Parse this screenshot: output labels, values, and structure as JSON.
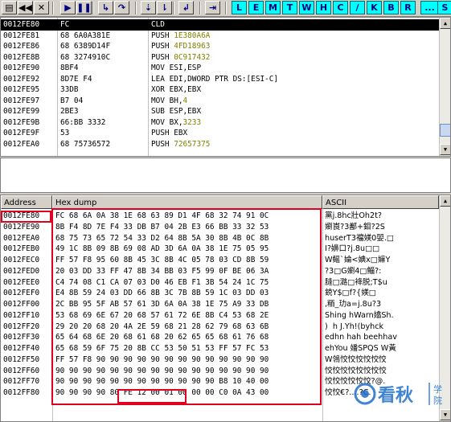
{
  "toolbar": {
    "buttons": [
      {
        "icon": "open-icon",
        "label": "▤"
      },
      {
        "icon": "rewind-icon",
        "label": "◀◀"
      },
      {
        "icon": "close-icon",
        "label": "✕"
      },
      {
        "icon": "run-icon",
        "label": "▶"
      },
      {
        "icon": "pause-icon",
        "label": "❚❚"
      },
      {
        "icon": "step-into-icon",
        "label": "↳"
      },
      {
        "icon": "step-over-icon",
        "label": "↷"
      },
      {
        "icon": "trace-into-icon",
        "label": "⇣"
      },
      {
        "icon": "trace-over-icon",
        "label": "⇂"
      },
      {
        "icon": "execute-till-return-icon",
        "label": "↲"
      },
      {
        "icon": "goto-icon",
        "label": "⇥"
      }
    ],
    "letters": [
      "L",
      "E",
      "M",
      "T",
      "W",
      "H",
      "C",
      "/",
      "K",
      "B",
      "R",
      "...",
      "S"
    ]
  },
  "disasm": {
    "rows": [
      {
        "addr": "0012FE80",
        "hex": "FC",
        "mnem": "CLD",
        "arg": ""
      },
      {
        "addr": "0012FE81",
        "hex": "68 6A0A381E",
        "mnem": "PUSH ",
        "arg": "1E380A6A"
      },
      {
        "addr": "0012FE86",
        "hex": "68 6389D14F",
        "mnem": "PUSH ",
        "arg": "4FD18963"
      },
      {
        "addr": "0012FE8B",
        "hex": "68 3274910C",
        "mnem": "PUSH ",
        "arg": "0C917432"
      },
      {
        "addr": "0012FE90",
        "hex": "8BF4",
        "mnem": "MOV ESI,ESP",
        "arg": ""
      },
      {
        "addr": "0012FE92",
        "hex": "8D7E F4",
        "mnem": "LEA EDI,DWORD PTR DS:[ESI-C]",
        "arg": ""
      },
      {
        "addr": "0012FE95",
        "hex": "33DB",
        "mnem": "XOR EBX,EBX",
        "arg": ""
      },
      {
        "addr": "0012FE97",
        "hex": "B7 04",
        "mnem": "MOV BH,",
        "arg": "4"
      },
      {
        "addr": "0012FE99",
        "hex": "2BE3",
        "mnem": "SUB ESP,EBX",
        "arg": ""
      },
      {
        "addr": "0012FE9B",
        "hex": "66:BB 3332",
        "mnem": "MOV BX,",
        "arg": "3233"
      },
      {
        "addr": "0012FE9F",
        "hex": "53",
        "mnem": "PUSH EBX",
        "arg": ""
      },
      {
        "addr": "0012FEA0",
        "hex": "68 75736572",
        "mnem": "PUSH ",
        "arg": "72657375"
      }
    ]
  },
  "dump": {
    "headers": {
      "address": "Address",
      "hex": "Hex dump",
      "ascii": "ASCII"
    },
    "rows": [
      {
        "addr": "0012FE80",
        "hex": "FC 68 6A 0A 38 1E 68 63 89 D1 4F 68 32 74 91 0C",
        "ascii": "黨j.8hc壯Oh2t?"
      },
      {
        "addr": "0012FE90",
        "hex": "8B F4 8D 7E F4 33 DB B7 04 2B E3 66 BB 33 32 53",
        "ascii": "嬼崀?3鄯+鉬?2S"
      },
      {
        "addr": "0012FEA0",
        "hex": "68 75 73 65 72 54 33 D2 64 8B 5A 30 8B 4B 0C 8B",
        "ascii": "huserT3襠媄0婯.□"
      },
      {
        "addr": "0012FEB0",
        "hex": "49 1C 8B 09 8B 69 08 AD 3D 6A 0A 38 1E 75 05 95",
        "ascii": "I?嬶口?j.8u□□"
      },
      {
        "addr": "0012FEC0",
        "hex": "FF 57 F8 95 60 8B 45 3C 8B 4C 05 78 03 CD 8B 59",
        "ascii": "W鳐`婨<婰x□嫲Y"
      },
      {
        "addr": "0012FED0",
        "hex": "20 03 DD 33 FF 47 8B 34 BB 03 F5 99 0F BE 06 3A",
        "ascii": "?3□G嬼4□鯔?:"
      },
      {
        "addr": "0012FEE0",
        "hex": "C4 74 08 C1 CA 07 03 D0 46 EB F1 3B 54 24 1C 75",
        "ascii": "膖□潞□袶脱;T$u"
      },
      {
        "addr": "0012FEF0",
        "hex": "E4 8B 59 24 03 DD 66 8B 3C 7B 8B 59 1C 03 DD 03",
        "ascii": "鋴Y$□f?{媄□"
      },
      {
        "addr": "0012FF00",
        "hex": "2C BB 95 5F AB 57 61 3D 6A 0A 38 1E 75 A9 33 DB",
        "ascii": ",粫_玏a=j.8u?3"
      },
      {
        "addr": "0012FF10",
        "hex": "53 68 69 6E 67 20 68 57 61 72 6E 8B C4 53 68 2E",
        "ascii": "Shing hWarn嬆Sh."
      },
      {
        "addr": "0012FF20",
        "hex": "29 20 20 68 20 4A 2E 59 68 21 28 62 79 68 63 6B",
        "ascii": ")  h J.Yh!(byhck"
      },
      {
        "addr": "0012FF30",
        "hex": "65 64 68 6E 20 68 61 68 20 62 65 65 68 61 76 68",
        "ascii": "edhn hah beehhav"
      },
      {
        "addr": "0012FF40",
        "hex": "65 68 59 6F 75 20 8B CC 53 50 51 53 FF 57 FC 53",
        "ascii": "ehYou 嬏SPQS W黃"
      },
      {
        "addr": "0012FF50",
        "hex": "FF 57 F8 90 90 90 90 90 90 90 90 90 90 90 90 90",
        "ascii": "W鴒恔恔恔恔恔恔"
      },
      {
        "addr": "0012FF60",
        "hex": "90 90 90 90 90 90 90 90 90 90 90 90 90 90 90 90",
        "ascii": "恔恔恔恔恔恔恔恔"
      },
      {
        "addr": "0012FF70",
        "hex": "90 90 90 90 90 90 90 90 90 90 90 90 B8 10 40 00",
        "ascii": "恔恔恔恔恔恔?@."
      },
      {
        "addr": "0012FF80",
        "hex": "90 90 90 90 80 FE 12 00 01 00 00 00 C0 0A 43 00",
        "ascii": "恔恔€?....?C."
      }
    ]
  },
  "watermark": {
    "text": "看秋",
    "small": "学\n院"
  }
}
